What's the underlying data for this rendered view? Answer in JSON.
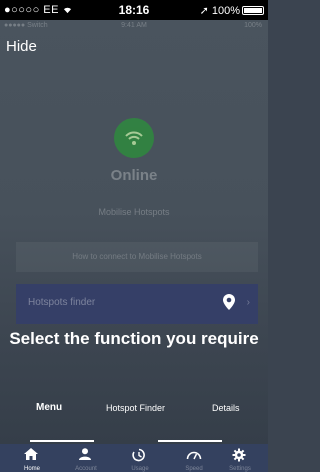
{
  "status_bar": {
    "carrier": "●○○○○ EE",
    "time": "18:16",
    "battery": "100%"
  },
  "inner_status": {
    "carrier": "●●●●● Switch",
    "time": "9:41 AM",
    "battery": "100%"
  },
  "header": {
    "hide_label": "Hide"
  },
  "status": {
    "title": "Online",
    "subtitle": "Mobilise Hotspots"
  },
  "how_to_button": "How to connect to Mobilise Hotspots",
  "finder_bar": {
    "label": "Hotspots finder",
    "chevron": "›"
  },
  "overlay_message": "Select the function you require",
  "tabs": [
    {
      "label": "Menu",
      "active": true
    },
    {
      "label": "Hotspot Finder",
      "active": false
    },
    {
      "label": "Details",
      "active": false
    }
  ],
  "bottom_nav": [
    {
      "label": "Home",
      "icon": "home-icon",
      "active": true
    },
    {
      "label": "Account",
      "icon": "account-icon",
      "active": false
    },
    {
      "label": "Usage",
      "icon": "usage-icon",
      "active": false
    },
    {
      "label": "Speed",
      "icon": "speed-icon",
      "active": false
    },
    {
      "label": "Settings",
      "icon": "settings-icon",
      "active": false
    }
  ],
  "colors": {
    "online_green": "#2f8a3e",
    "finder_bar": "#353f67",
    "bottom_nav": "#34415f"
  }
}
